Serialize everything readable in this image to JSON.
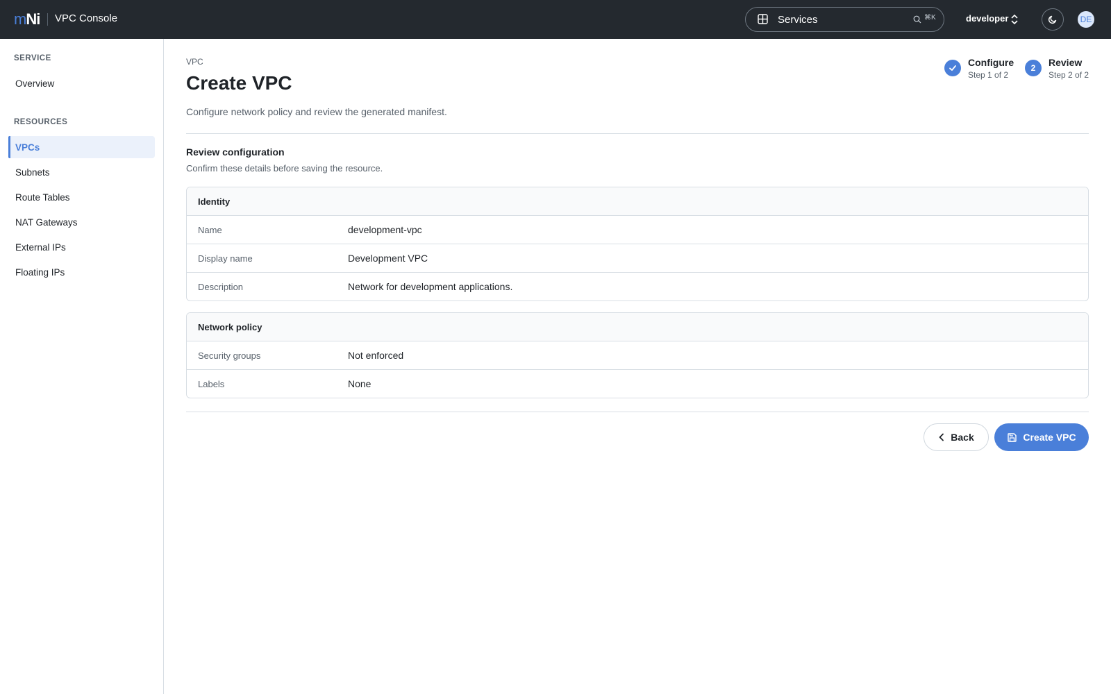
{
  "header": {
    "logo_m": "m",
    "logo_ni": "Ni",
    "app_title": "VPC Console",
    "services_label": "Services",
    "search_shortcut": "⌘K",
    "namespace": "developer",
    "avatar_initials": "DE"
  },
  "sidebar": {
    "sections": [
      {
        "title": "SERVICE",
        "items": [
          {
            "label": "Overview",
            "active": false
          }
        ]
      },
      {
        "title": "RESOURCES",
        "items": [
          {
            "label": "VPCs",
            "active": true
          },
          {
            "label": "Subnets",
            "active": false
          },
          {
            "label": "Route Tables",
            "active": false
          },
          {
            "label": "NAT Gateways",
            "active": false
          },
          {
            "label": "External IPs",
            "active": false
          },
          {
            "label": "Floating IPs",
            "active": false
          }
        ]
      }
    ]
  },
  "main": {
    "breadcrumb": "VPC",
    "title": "Create VPC",
    "subtitle": "Configure network policy and review the generated manifest.",
    "steps": [
      {
        "title": "Configure",
        "sub": "Step 1 of 2",
        "badge": "",
        "state": "done"
      },
      {
        "title": "Review",
        "sub": "Step 2 of 2",
        "badge": "2",
        "state": "current"
      }
    ],
    "review_title": "Review configuration",
    "review_sub": "Confirm these details before saving the resource.",
    "cards": [
      {
        "title": "Identity",
        "rows": [
          {
            "key": "Name",
            "value": "development-vpc"
          },
          {
            "key": "Display name",
            "value": "Development VPC"
          },
          {
            "key": "Description",
            "value": "Network for development applications."
          }
        ]
      },
      {
        "title": "Network policy",
        "rows": [
          {
            "key": "Security groups",
            "value": "Not enforced"
          },
          {
            "key": "Labels",
            "value": "None"
          }
        ]
      }
    ],
    "back_label": "Back",
    "create_label": "Create VPC"
  },
  "colors": {
    "accent": "#4a7fd9",
    "topbar": "#24292f"
  }
}
